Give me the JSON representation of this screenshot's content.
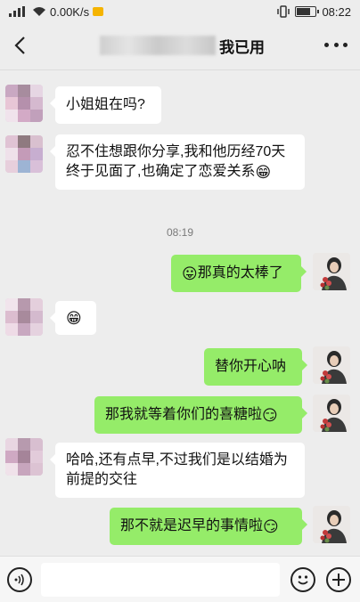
{
  "status_bar": {
    "network": "4G",
    "speed": "0.00K/s",
    "time": "08:22",
    "battery_level": 0.65,
    "icons": [
      "signal-icon",
      "wifi-icon",
      "notification-icon",
      "vibrate-icon",
      "battery-icon"
    ]
  },
  "header": {
    "title_suffix": "我已用",
    "back_icon": "chevron-left-icon",
    "more_icon": "more-dots-icon"
  },
  "messages": [
    {
      "side": "left",
      "text": "小姐姐在吗?"
    },
    {
      "side": "left",
      "text": "忍不住想跟你分享,我和他历经70天终于见面了,也确定了恋爱关系",
      "emoji": "😁"
    },
    {
      "side": "right",
      "text": "那真的太棒了",
      "emoji_before": "😛"
    },
    {
      "side": "left",
      "text": "",
      "emoji": "😁"
    },
    {
      "side": "right",
      "text": "替你开心呐"
    },
    {
      "side": "right",
      "text": "那我就等着你们的喜糖啦",
      "emoji": "😏"
    },
    {
      "side": "left",
      "text": "哈哈,还有点早,不过我们是以结婚为前提的交往"
    },
    {
      "side": "right",
      "text": "那不就是迟早的事情啦",
      "emoji": "😏"
    }
  ],
  "timestamp": "08:19",
  "input_bar": {
    "placeholder": "",
    "voice_icon": "voice-icon",
    "emoji_icon": "emoji-icon",
    "plus_icon": "plus-icon"
  },
  "colors": {
    "background": "#ededed",
    "bubble_sent": "#95ec69",
    "bubble_received": "#ffffff"
  }
}
